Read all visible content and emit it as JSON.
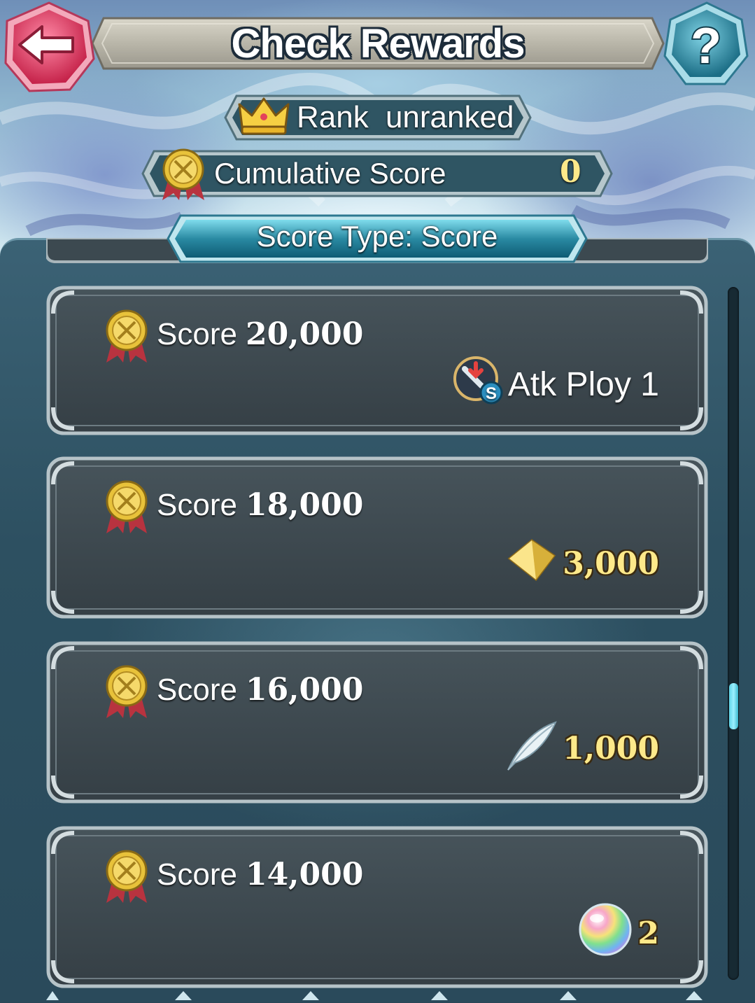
{
  "header": {
    "title": "Check Rewards",
    "back_icon": "back-arrow-icon",
    "help_icon": "question-icon",
    "help_label": "?"
  },
  "rank": {
    "label": "Rank",
    "value": "unranked",
    "icon": "crown-icon"
  },
  "cumulative": {
    "label": "Cumulative Score",
    "value": "0",
    "icon": "score-medal-icon"
  },
  "score_type": {
    "label": "Score Type: Score"
  },
  "rewards": [
    {
      "score_word": "Score",
      "score_value": "20,000",
      "reward_icon": "skill-scroll-icon",
      "reward_badge": "S",
      "reward_text": "Atk Ploy 1"
    },
    {
      "score_word": "Score",
      "score_value": "18,000",
      "reward_icon": "gold-crystal-icon",
      "reward_text": "3,000"
    },
    {
      "score_word": "Score",
      "score_value": "16,000",
      "reward_icon": "feather-icon",
      "reward_text": "1,000"
    },
    {
      "score_word": "Score",
      "score_value": "14,000",
      "reward_icon": "rainbow-orb-icon",
      "reward_text": "2"
    }
  ],
  "colors": {
    "panel": "#2d5061",
    "card": "#3c4950",
    "reward_gold": "#fde98a",
    "accent_cyan": "#5fd3e6",
    "back_button": "#e0456a",
    "help_button": "#2d8ea6"
  }
}
